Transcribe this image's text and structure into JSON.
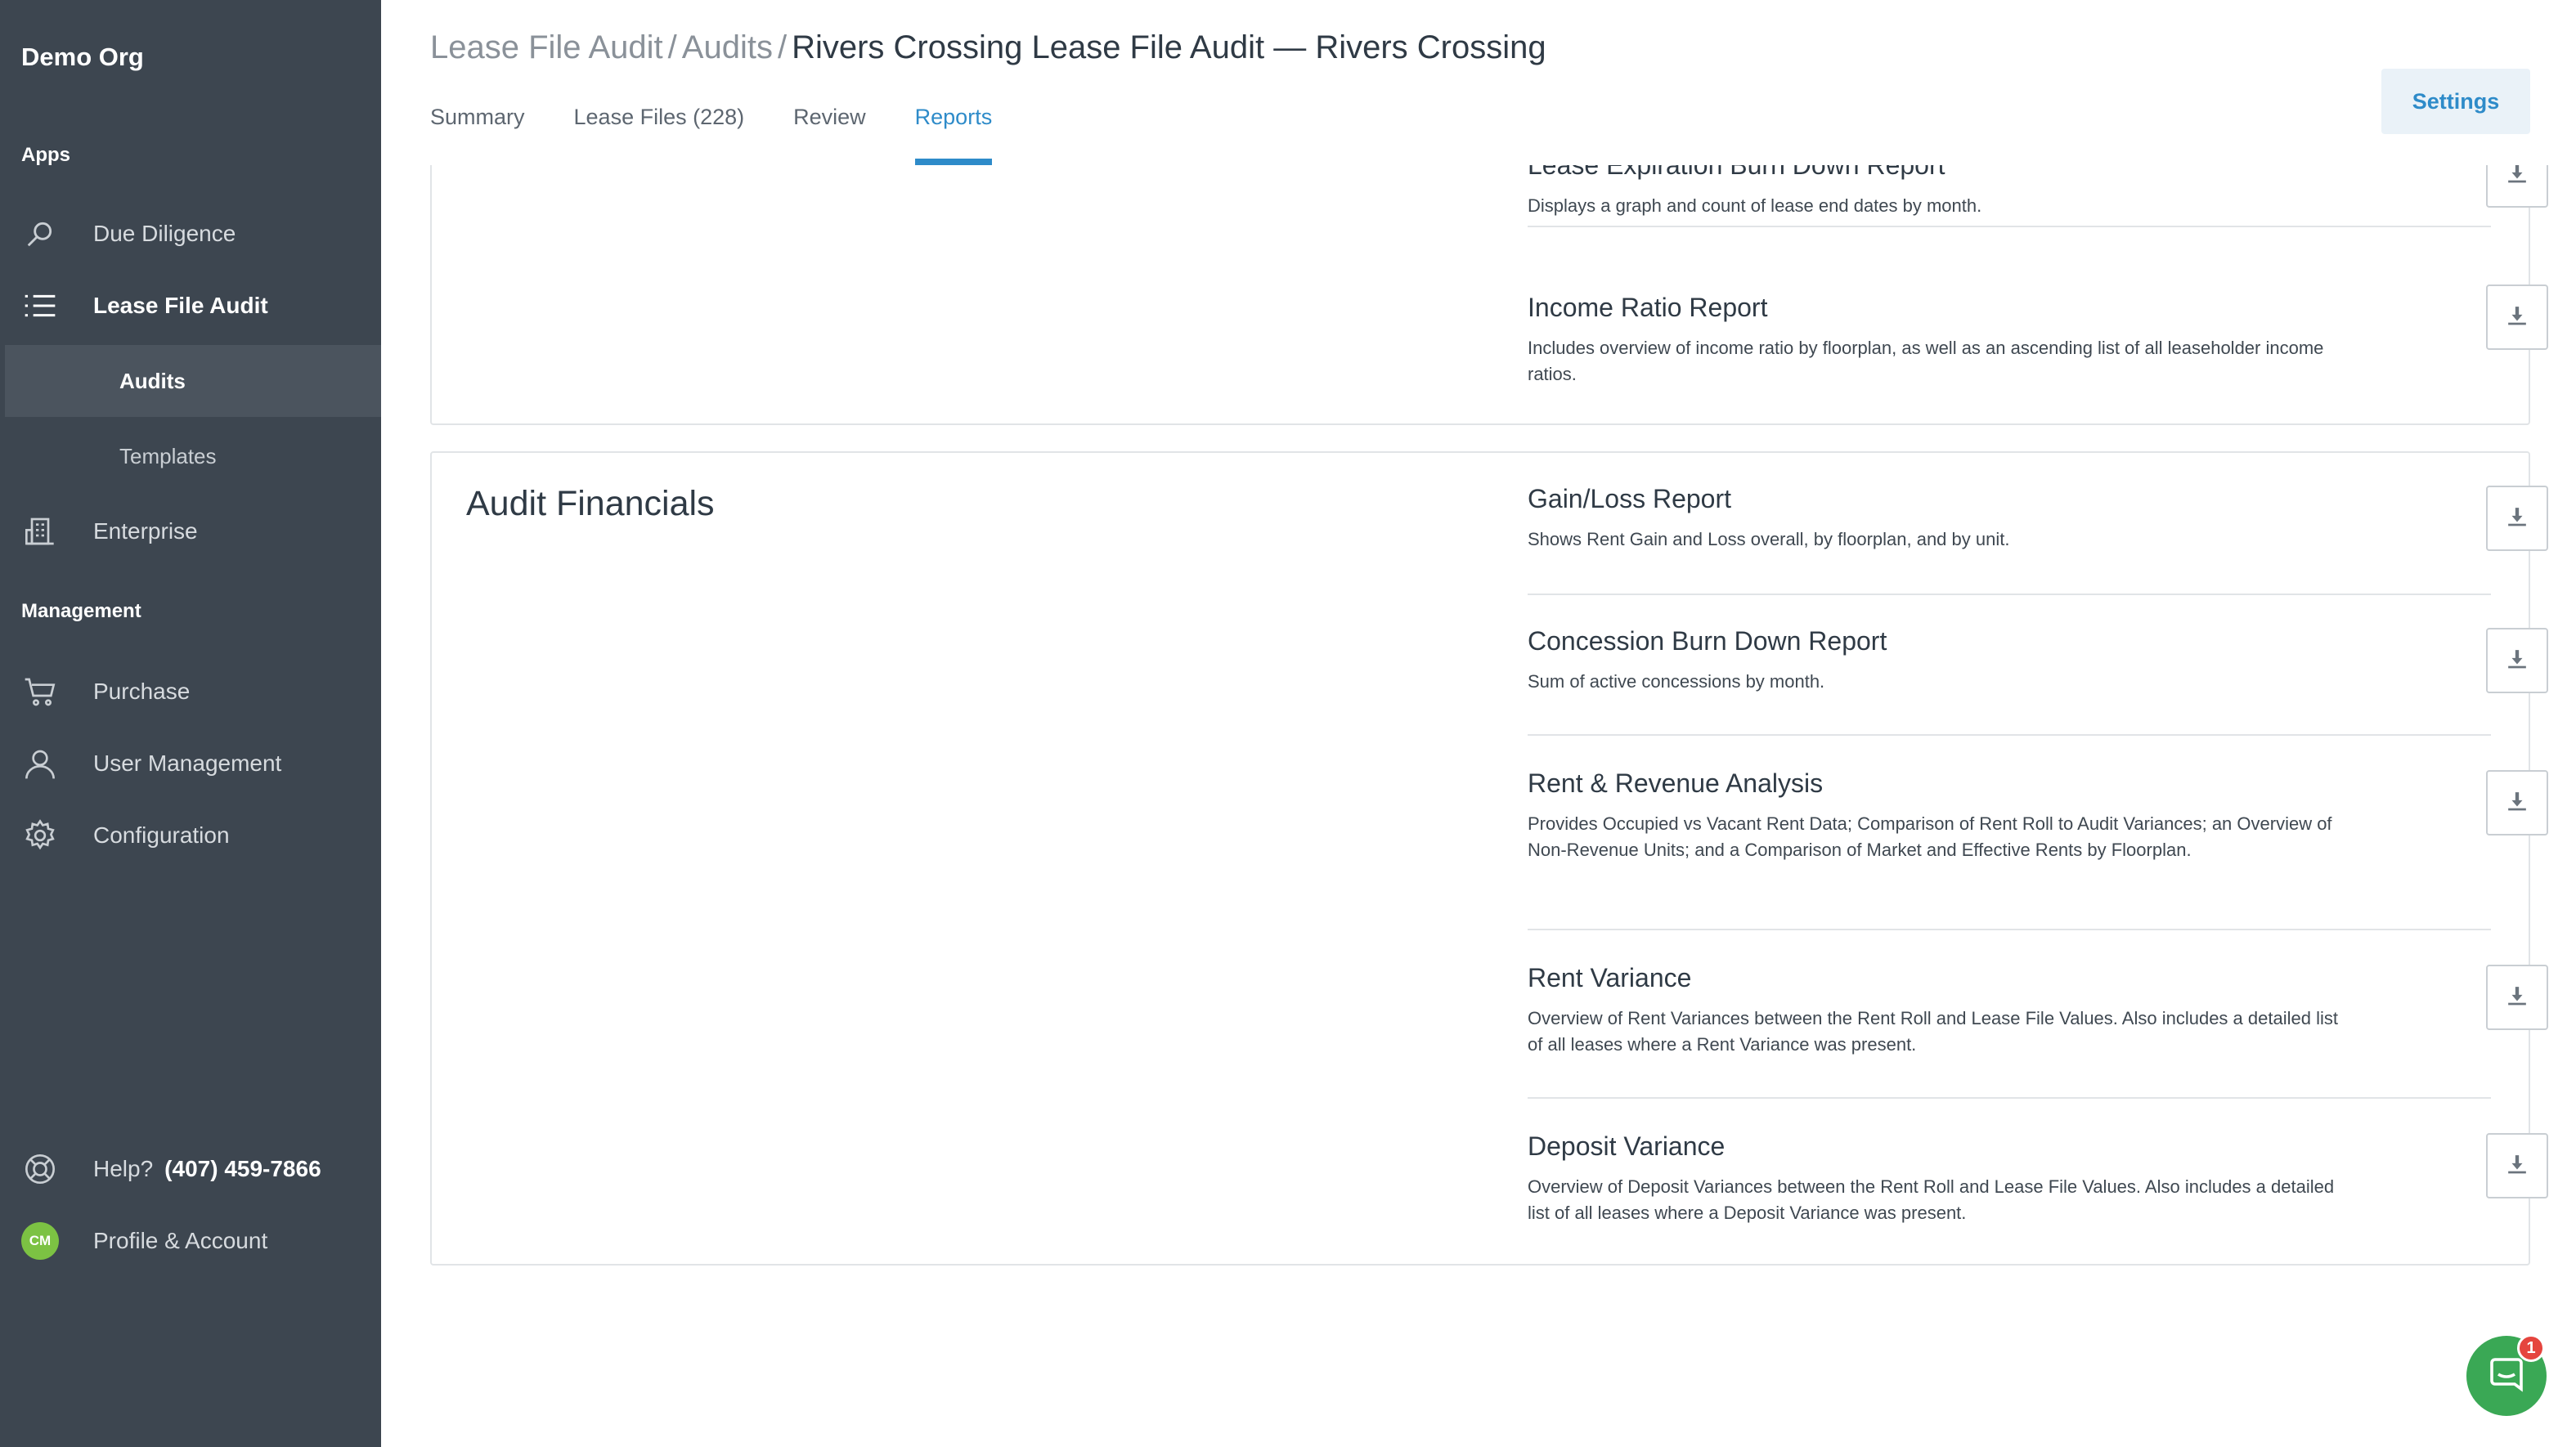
{
  "sidebar": {
    "org_name": "Demo Org",
    "apps_label": "Apps",
    "management_label": "Management",
    "apps": [
      {
        "label": "Due Diligence",
        "icon": "search-icon"
      },
      {
        "label": "Lease File Audit",
        "icon": "list-icon"
      }
    ],
    "sub_items": [
      {
        "label": "Audits",
        "active": true
      },
      {
        "label": "Templates",
        "active": false
      }
    ],
    "enterprise": {
      "label": "Enterprise",
      "icon": "building-icon"
    },
    "management": [
      {
        "label": "Purchase",
        "icon": "cart-icon"
      },
      {
        "label": "User Management",
        "icon": "user-icon"
      },
      {
        "label": "Configuration",
        "icon": "gear-icon"
      }
    ],
    "help": {
      "label": "Help?",
      "phone": "(407) 459-7866",
      "icon": "lifebuoy-icon"
    },
    "profile": {
      "label": "Profile & Account",
      "initials": "CM"
    }
  },
  "header": {
    "breadcrumb": [
      "Lease File Audit",
      "Audits"
    ],
    "separator": "/",
    "current": "Rivers Crossing Lease File Audit — Rivers Crossing",
    "tabs": [
      {
        "label": "Summary",
        "active": false
      },
      {
        "label": "Lease Files (228)",
        "active": false
      },
      {
        "label": "Review",
        "active": false
      },
      {
        "label": "Reports",
        "active": true
      }
    ],
    "settings_label": "Settings",
    "accent_color": "#2e8bc9"
  },
  "sections": [
    {
      "title": "",
      "reports": [
        {
          "title": "Lease Expiration Burn Down Report",
          "description": "Displays a graph and count of lease end dates by month."
        },
        {
          "title": "Income Ratio Report",
          "description": "Includes overview of income ratio by floorplan, as well as an ascending list of all leaseholder income ratios."
        }
      ]
    },
    {
      "title": "Audit Financials",
      "reports": [
        {
          "title": "Gain/Loss Report",
          "description": "Shows Rent Gain and Loss overall, by floorplan, and by unit."
        },
        {
          "title": "Concession Burn Down Report",
          "description": "Sum of active concessions by month."
        },
        {
          "title": "Rent & Revenue Analysis",
          "description": "Provides Occupied vs Vacant Rent Data; Comparison of Rent Roll to Audit Variances; an Overview of Non-Revenue Units; and a Comparison of Market and Effective Rents by Floorplan."
        },
        {
          "title": "Rent Variance",
          "description": "Overview of Rent Variances between the Rent Roll and Lease File Values. Also includes a detailed list of all leases where a Rent Variance was present."
        },
        {
          "title": "Deposit Variance",
          "description": "Overview of Deposit Variances between the Rent Roll and Lease File Values. Also includes a detailed list of all leases where a Deposit Variance was present."
        }
      ]
    }
  ],
  "chat": {
    "badge_count": "1",
    "icon": "chat-icon"
  }
}
